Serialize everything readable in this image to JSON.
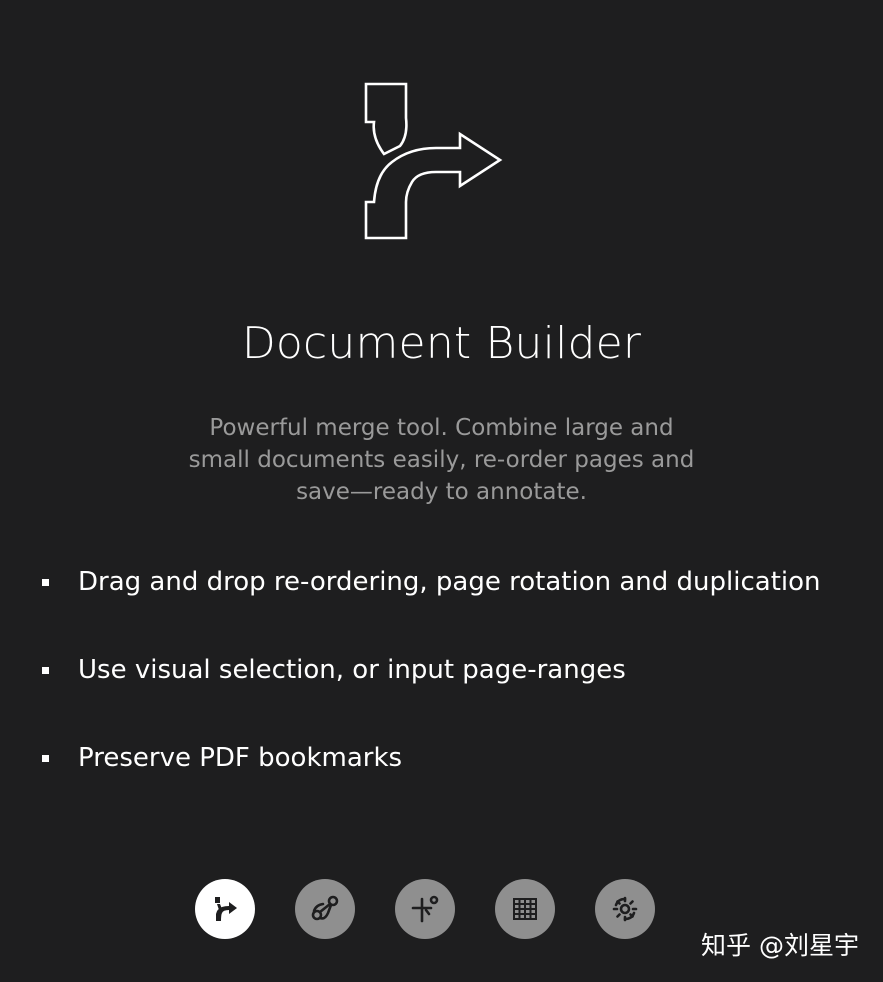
{
  "screen": {
    "title": "Document Builder",
    "description": "Powerful merge tool. Combine large and small documents easily, re-order pages and save—ready to annotate.",
    "hero_icon": "merge-arrow-icon",
    "features": [
      {
        "text": "Drag and drop re-ordering, page rotation and duplication"
      },
      {
        "text": "Use visual selection, or input page-ranges"
      },
      {
        "text": "Preserve PDF bookmarks"
      }
    ]
  },
  "pager": {
    "active_index": 0,
    "items": [
      {
        "icon": "merge-arrow-icon",
        "active": true
      },
      {
        "icon": "scissors-icon",
        "active": false
      },
      {
        "icon": "crop-icon",
        "active": false
      },
      {
        "icon": "grid-icon",
        "active": false
      },
      {
        "icon": "rotate-gear-icon",
        "active": false
      }
    ]
  },
  "watermark": {
    "text": "知乎 @刘星宇"
  },
  "colors": {
    "background": "#1e1e1f",
    "text": "#ffffff",
    "description": "#9a9a9a",
    "pager_inactive": "#8f8f8f",
    "pager_active": "#ffffff"
  }
}
